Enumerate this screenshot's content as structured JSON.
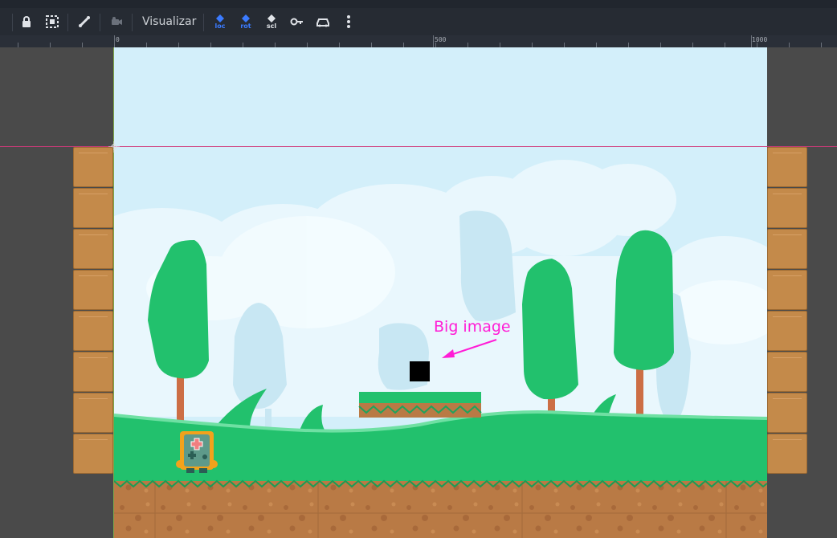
{
  "toolbar": {
    "view_label": "Visualizar",
    "icons": [
      "lock-icon",
      "group-icon",
      "bone-icon",
      "camera-icon",
      "loc-key-icon",
      "rot-key-icon",
      "scl-key-icon",
      "key-icon",
      "car-icon",
      "more-vertical-icon"
    ],
    "key_labels": {
      "loc": "loc",
      "rot": "rot",
      "scl": "scl"
    }
  },
  "ruler": {
    "labels": [
      "0",
      "500",
      "1000"
    ]
  },
  "scene": {
    "annotation": "Big image"
  },
  "colors": {
    "sky": "#d3effa",
    "grass": "#22c16d",
    "dirt": "#b97a45",
    "annotation": "#ff1dd6",
    "guide_h": "#d03a7a",
    "guide_v": "#7ea84a",
    "key_blue": "#3b7bff"
  }
}
